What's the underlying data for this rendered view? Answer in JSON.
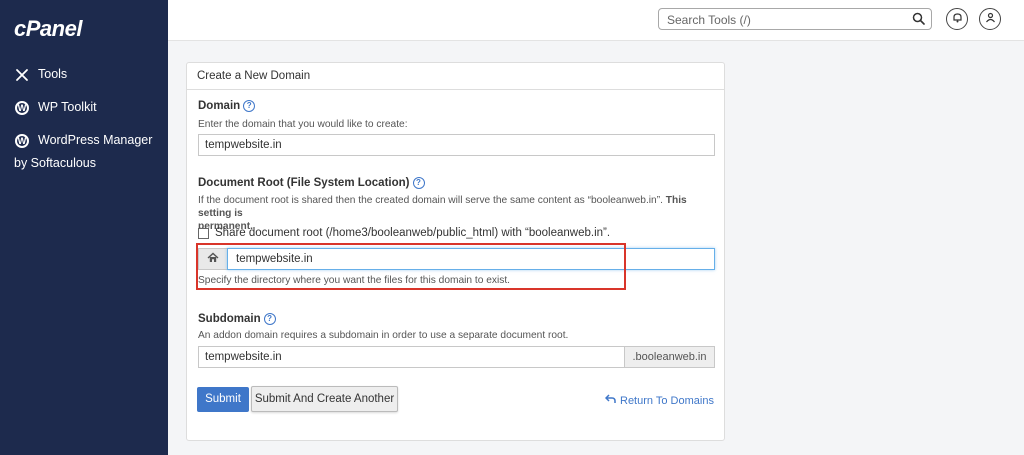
{
  "app": {
    "logo": "cPanel"
  },
  "sidebar": {
    "items": [
      {
        "label": "Tools",
        "icon": "tools-icon"
      },
      {
        "label": "WP Toolkit",
        "icon": "wordpress-icon"
      },
      {
        "label": "WordPress Manager",
        "label2": "by Softaculous",
        "icon": "wordpress-icon"
      }
    ]
  },
  "header": {
    "search_placeholder": "Search Tools (/)"
  },
  "form": {
    "title": "Create a New Domain",
    "domain": {
      "label": "Domain",
      "description": "Enter the domain that you would like to create:",
      "value": "tempwebsite.in"
    },
    "docroot": {
      "label": "Document Root (File System Location)",
      "description": "If the document root is shared then the created domain will serve the same content as “booleanweb.in”.",
      "description_bold_1": "This setting is",
      "description_bold_2": "permanent.",
      "share_label": "Share document root (/home3/booleanweb/public_html) with “booleanweb.in”.",
      "share_checked": false,
      "value": "tempwebsite.in",
      "hint": "Specify the directory where you want the files for this domain to exist."
    },
    "subdomain": {
      "label": "Subdomain",
      "description": "An addon domain requires a subdomain in order to use a separate document root.",
      "value": "tempwebsite.in",
      "suffix": ".booleanweb.in"
    },
    "submit_label": "Submit",
    "submit_another_label": "Submit And Create Another",
    "return_label": "Return To Domains"
  },
  "colors": {
    "sidebar": "#1d2a4d",
    "primary": "#3f77c9",
    "highlight": "#d9352a"
  }
}
